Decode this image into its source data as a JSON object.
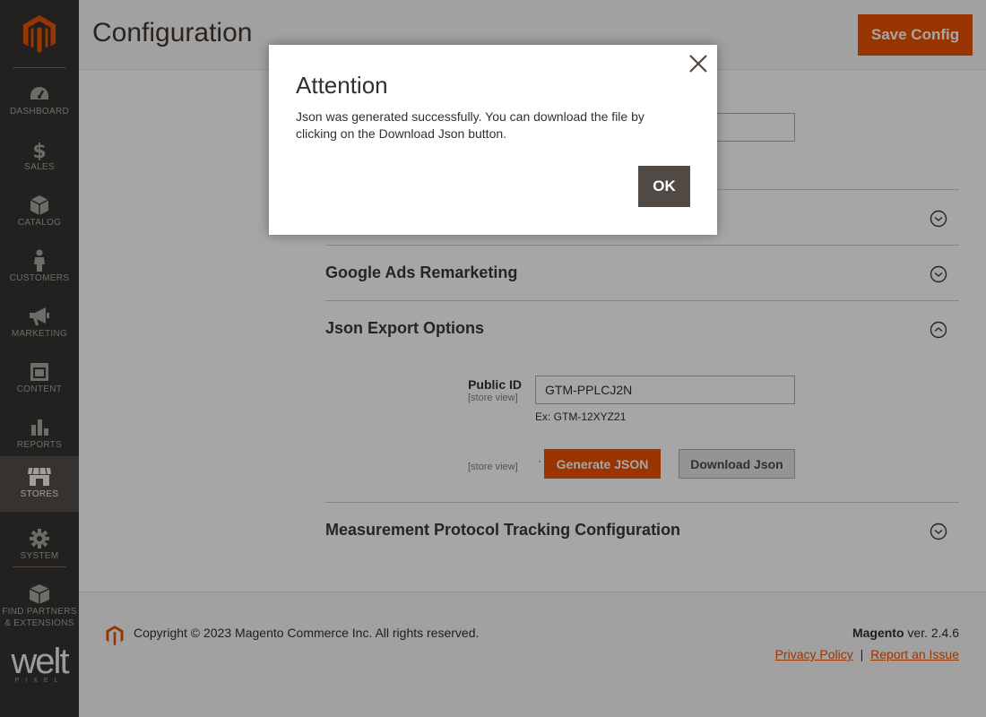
{
  "sidebar": {
    "logo": "magento-logo-icon",
    "items": [
      {
        "label": "DASHBOARD",
        "icon": "dashboard-icon"
      },
      {
        "label": "SALES",
        "icon": "dollar-icon"
      },
      {
        "label": "CATALOG",
        "icon": "box-icon"
      },
      {
        "label": "CUSTOMERS",
        "icon": "person-icon"
      },
      {
        "label": "MARKETING",
        "icon": "megaphone-icon"
      },
      {
        "label": "CONTENT",
        "icon": "layout-icon"
      },
      {
        "label": "REPORTS",
        "icon": "bar-chart-icon"
      },
      {
        "label": "STORES",
        "icon": "store-icon",
        "active": true
      },
      {
        "label": "SYSTEM",
        "icon": "gear-icon"
      }
    ],
    "partners": {
      "line1": "FIND PARTNERS",
      "line2": "& EXTENSIONS",
      "icon": "cube-icon"
    },
    "brand": {
      "name": "welt",
      "sub": "PIXEL"
    }
  },
  "header": {
    "title": "Configuration",
    "save_label": "Save Config"
  },
  "sections": {
    "google_ads": "Google Ads Remarketing",
    "json_export": "Json Export Options",
    "measurement": "Measurement Protocol Tracking Configuration"
  },
  "json_export": {
    "public_id_label": "Public ID",
    "scope": "[store view]",
    "public_id_value": "GTM-PPLCJ2N",
    "note": "Ex: GTM-12XYZ21",
    "action_scope": "[store view]",
    "dot": "·",
    "generate_label": "Generate JSON",
    "download_label": "Download Json"
  },
  "footer": {
    "copyright": "Copyright © 2023 Magento Commerce Inc. All rights reserved.",
    "product": "Magento",
    "version": " ver. 2.4.6",
    "privacy": "Privacy Policy",
    "separator": "|",
    "report": "Report an Issue"
  },
  "modal": {
    "title": "Attention",
    "message": "Json was generated successfully. You can download the file by clicking on the Download Json button.",
    "ok_label": "OK"
  },
  "colors": {
    "accent": "#eb5202",
    "sidebar": "#373330",
    "sidebar_active": "#524d49",
    "modal_button": "#514943"
  }
}
